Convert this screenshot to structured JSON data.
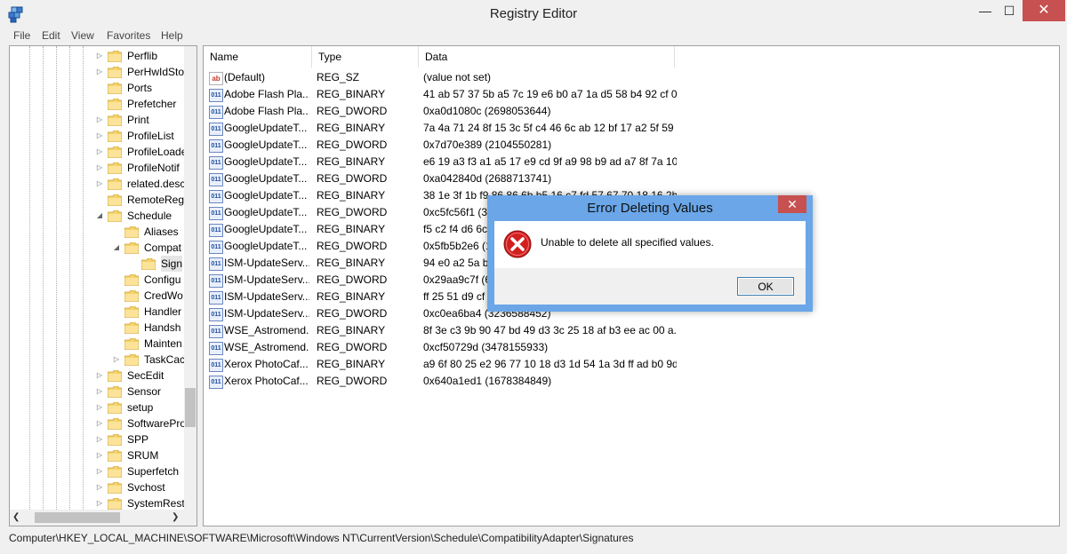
{
  "window": {
    "title": "Registry Editor",
    "min": "—",
    "max": "☐",
    "close": "✕"
  },
  "menu": [
    "File",
    "Edit",
    "View",
    "Favorites",
    "Help"
  ],
  "tree": [
    {
      "label": "Perflib",
      "exp": "▷"
    },
    {
      "label": "PerHwIdSto",
      "exp": "▷"
    },
    {
      "label": "Ports",
      "exp": ""
    },
    {
      "label": "Prefetcher",
      "exp": ""
    },
    {
      "label": "Print",
      "exp": "▷"
    },
    {
      "label": "ProfileList",
      "exp": "▷"
    },
    {
      "label": "ProfileLoade",
      "exp": "▷"
    },
    {
      "label": "ProfileNotif",
      "exp": "▷"
    },
    {
      "label": "related.desc",
      "exp": "▷"
    },
    {
      "label": "RemoteReg",
      "exp": ""
    },
    {
      "label": "Schedule",
      "exp": "◢"
    },
    {
      "label": "Aliases",
      "exp": ""
    },
    {
      "label": "Compat",
      "exp": "◢"
    },
    {
      "label": "Sign",
      "exp": ""
    },
    {
      "label": "Configu",
      "exp": ""
    },
    {
      "label": "CredWo",
      "exp": ""
    },
    {
      "label": "Handler",
      "exp": ""
    },
    {
      "label": "Handsh",
      "exp": ""
    },
    {
      "label": "Mainten",
      "exp": ""
    },
    {
      "label": "TaskCac",
      "exp": "▷"
    },
    {
      "label": "SecEdit",
      "exp": "▷"
    },
    {
      "label": "Sensor",
      "exp": "▷"
    },
    {
      "label": "setup",
      "exp": "▷"
    },
    {
      "label": "SoftwarePro",
      "exp": "▷"
    },
    {
      "label": "SPP",
      "exp": "▷"
    },
    {
      "label": "SRUM",
      "exp": "▷"
    },
    {
      "label": "Superfetch",
      "exp": "▷"
    },
    {
      "label": "Svchost",
      "exp": "▷"
    },
    {
      "label": "SystemResto",
      "exp": "▷"
    }
  ],
  "list": {
    "headers": {
      "name": "Name",
      "type": "Type",
      "data": "Data"
    },
    "rows": [
      {
        "icon": "ab",
        "name": "(Default)",
        "type": "REG_SZ",
        "data": "(value not set)"
      },
      {
        "icon": "011",
        "name": "Adobe Flash Pla...",
        "type": "REG_BINARY",
        "data": "41 ab 57 37 5b a5 7c 19 e6 b0 a7 1a d5 58 b4 92 cf 0..."
      },
      {
        "icon": "011",
        "name": "Adobe Flash Pla...",
        "type": "REG_DWORD",
        "data": "0xa0d1080c (2698053644)"
      },
      {
        "icon": "011",
        "name": "GoogleUpdateT...",
        "type": "REG_BINARY",
        "data": "7a 4a 71 24 8f 15 3c 5f c4 46 6c ab 12 bf 17 a2 5f 59 ..."
      },
      {
        "icon": "011",
        "name": "GoogleUpdateT...",
        "type": "REG_DWORD",
        "data": "0x7d70e389 (2104550281)"
      },
      {
        "icon": "011",
        "name": "GoogleUpdateT...",
        "type": "REG_BINARY",
        "data": "e6 19 a3 f3 a1 a5 17 e9 cd 9f a9 98 b9 ad a7 8f 7a 10 ..."
      },
      {
        "icon": "011",
        "name": "GoogleUpdateT...",
        "type": "REG_DWORD",
        "data": "0xa042840d (2688713741)"
      },
      {
        "icon": "011",
        "name": "GoogleUpdateT...",
        "type": "REG_BINARY",
        "data": "38 1e 3f 1b f9 86 86 6b b5 16 c7 fd 57 67 70 18 16 2b ..."
      },
      {
        "icon": "011",
        "name": "GoogleUpdateT...",
        "type": "REG_DWORD",
        "data": "0xc5fc56f1 (33..."
      },
      {
        "icon": "011",
        "name": "GoogleUpdateT...",
        "type": "REG_BINARY",
        "data": "f5 c2 f4 d6 6c"
      },
      {
        "icon": "011",
        "name": "GoogleUpdateT...",
        "type": "REG_DWORD",
        "data": "0x5fb5b2e6 (1..."
      },
      {
        "icon": "011",
        "name": "ISM-UpdateServ...",
        "type": "REG_BINARY",
        "data": "94 e0 a2 5a b3"
      },
      {
        "icon": "011",
        "name": "ISM-UpdateServ...",
        "type": "REG_DWORD",
        "data": "0x29aa9c7f (69..."
      },
      {
        "icon": "011",
        "name": "ISM-UpdateServ...",
        "type": "REG_BINARY",
        "data": "ff 25 51 d9 cf 4..."
      },
      {
        "icon": "011",
        "name": "ISM-UpdateServ...",
        "type": "REG_DWORD",
        "data": "0xc0ea6ba4 (3236588452)"
      },
      {
        "icon": "011",
        "name": "WSE_Astromend...",
        "type": "REG_BINARY",
        "data": "8f 3e c3 9b 90 47 bd 49 d3 3c 25 18 af b3 ee ac 00 a..."
      },
      {
        "icon": "011",
        "name": "WSE_Astromend...",
        "type": "REG_DWORD",
        "data": "0xcf50729d (3478155933)"
      },
      {
        "icon": "011",
        "name": "Xerox PhotoCaf...",
        "type": "REG_BINARY",
        "data": "a9 6f 80 25 e2 96 77 10 18 d3 1d 54 1a 3d ff ad b0 9d..."
      },
      {
        "icon": "011",
        "name": "Xerox PhotoCaf...",
        "type": "REG_DWORD",
        "data": "0x640a1ed1 (1678384849)"
      }
    ]
  },
  "status": "Computer\\HKEY_LOCAL_MACHINE\\SOFTWARE\\Microsoft\\Windows NT\\CurrentVersion\\Schedule\\CompatibilityAdapter\\Signatures",
  "dialog": {
    "title": "Error Deleting Values",
    "close": "✕",
    "message": "Unable to delete all specified values.",
    "ok": "OK"
  },
  "colors": {
    "dialog_frame": "#6aa6e8",
    "close_red": "#c75050",
    "error_red": "#d21f1f"
  },
  "icons": {
    "app": "registry-editor-icon",
    "error": "error-x-icon",
    "folder": "folder-icon"
  }
}
